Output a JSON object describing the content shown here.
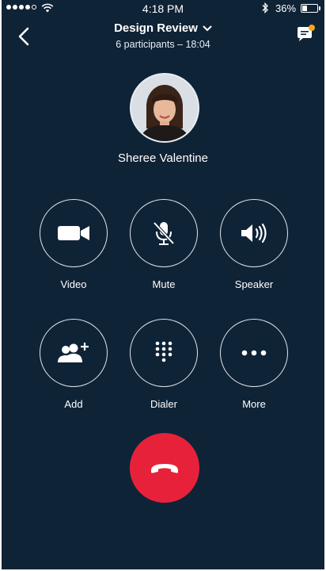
{
  "status_bar": {
    "time": "4:18 PM",
    "battery_text": "36%",
    "battery_level": 0.36,
    "signal_bars_filled": 4,
    "signal_bars_total": 5
  },
  "header": {
    "title": "Design Review",
    "subtitle": "6 participants – 18:04",
    "back_icon": "chevron-left-icon",
    "chat_icon": "chat-bubble-icon",
    "chat_has_notification": true
  },
  "participant": {
    "name": "Sheree Valentine"
  },
  "controls": [
    {
      "label": "Video",
      "icon": "video-camera-icon"
    },
    {
      "label": "Mute",
      "icon": "mic-off-icon"
    },
    {
      "label": "Speaker",
      "icon": "speaker-icon"
    },
    {
      "label": "Add",
      "icon": "add-participant-icon"
    },
    {
      "label": "Dialer",
      "icon": "dialpad-icon"
    },
    {
      "label": "More",
      "icon": "more-icon"
    }
  ],
  "end_call": {
    "icon": "hang-up-icon"
  },
  "colors": {
    "background": "#0f2337",
    "end_call": "#e8213a",
    "notification": "#f5a623",
    "ring": "#dfe6ec"
  }
}
